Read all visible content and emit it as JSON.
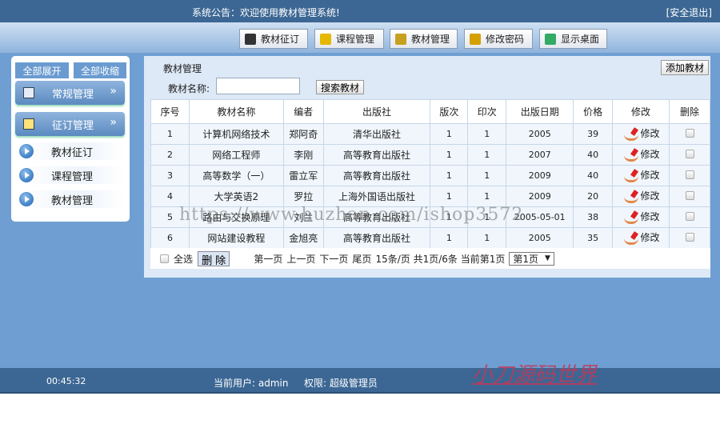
{
  "header": {
    "notice": "系统公告：欢迎使用教材管理系统!",
    "logout": "[安全退出]"
  },
  "toolbar": [
    {
      "label": "教材征订",
      "icon": "clipboard-icon",
      "color": "#333"
    },
    {
      "label": "课程管理",
      "icon": "tag-icon",
      "color": "#e6b800"
    },
    {
      "label": "教材管理",
      "icon": "book-icon",
      "color": "#c8a020"
    },
    {
      "label": "修改密码",
      "icon": "key-icon",
      "color": "#d6a000"
    },
    {
      "label": "显示桌面",
      "icon": "desktop-icon",
      "color": "#3a6"
    }
  ],
  "sidebar": {
    "expand_all": "全部展开",
    "collapse_all": "全部收缩",
    "groups": [
      {
        "label": "常规管理",
        "icon": "notepad-icon"
      },
      {
        "label": "征订管理",
        "icon": "list-icon"
      }
    ],
    "items": [
      {
        "label": "教材征订"
      },
      {
        "label": "课程管理"
      },
      {
        "label": "教材管理"
      }
    ]
  },
  "content": {
    "title": "教材管理",
    "add_button": "添加教材",
    "search_label": "教材名称:",
    "search_value": "",
    "search_button": "搜索教材",
    "columns": [
      "序号",
      "教材名称",
      "编者",
      "出版社",
      "版次",
      "印次",
      "出版日期",
      "价格",
      "修改",
      "删除"
    ],
    "rows": [
      [
        "1",
        "计算机网络技术",
        "郑阿奇",
        "清华出版社",
        "1",
        "1",
        "2005",
        "39"
      ],
      [
        "2",
        "网络工程师",
        "李刚",
        "高等教育出版社",
        "1",
        "1",
        "2007",
        "40"
      ],
      [
        "3",
        "高等数学（一）",
        "雷立军",
        "高等教育出版社",
        "1",
        "1",
        "2009",
        "40"
      ],
      [
        "4",
        "大学英语2",
        "罗拉",
        "上海外国语出版社",
        "1",
        "1",
        "2009",
        "20"
      ],
      [
        "5",
        "路由与交换原理",
        "刘兰",
        "高等教育出版社",
        "1",
        "1",
        "2005-05-01",
        "38"
      ],
      [
        "6",
        "网站建设教程",
        "金旭亮",
        "高等教育出版社",
        "1",
        "1",
        "2005",
        "35"
      ]
    ],
    "edit_label": "修改",
    "pager": {
      "select_all": "全选",
      "delete": "删 除",
      "first": "第一页",
      "prev": "上一页",
      "next": "下一页",
      "last": "尾页",
      "info": "15条/页 共1页/6条 当前第1页",
      "page_select": "第1页"
    }
  },
  "footer": {
    "time": "00:45:32",
    "user": "当前用户: admin",
    "role": "权限: 超级管理员",
    "brand": "小刀源码世界"
  },
  "watermark": "https://www.huzhan.com/ishop3572"
}
